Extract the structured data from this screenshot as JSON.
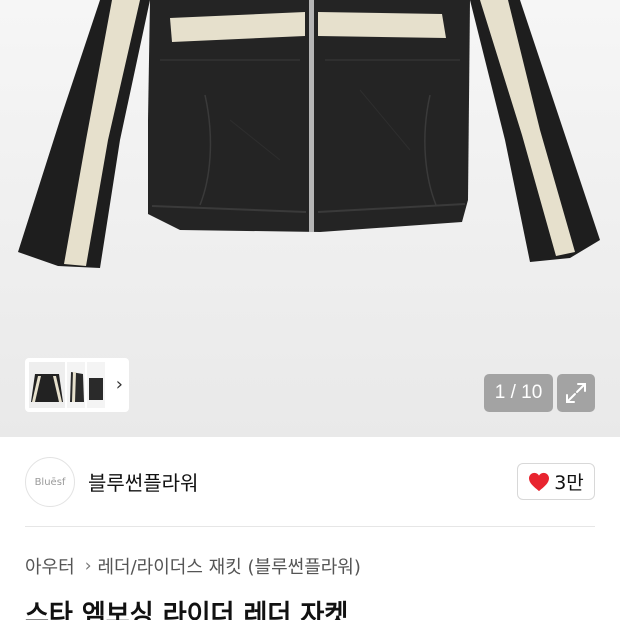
{
  "gallery": {
    "counter_text": "1 / 10",
    "thumbnail_count": 3,
    "colors": {
      "jacket": "#1f1f1f",
      "stripe": "#e6e0cc",
      "background": "#f2f2f2"
    }
  },
  "store": {
    "logo_text": "Bluēsf",
    "name": "블루썬플라워",
    "like_count": "3만",
    "like_icon": "heart-icon",
    "like_color": "#e8242f"
  },
  "breadcrumb": {
    "category": "아우터",
    "subcategory": "레더/라이더스 재킷 (블루썬플라워)"
  },
  "product": {
    "title": "스타 엠보싱 라이더 레더 자켓"
  }
}
